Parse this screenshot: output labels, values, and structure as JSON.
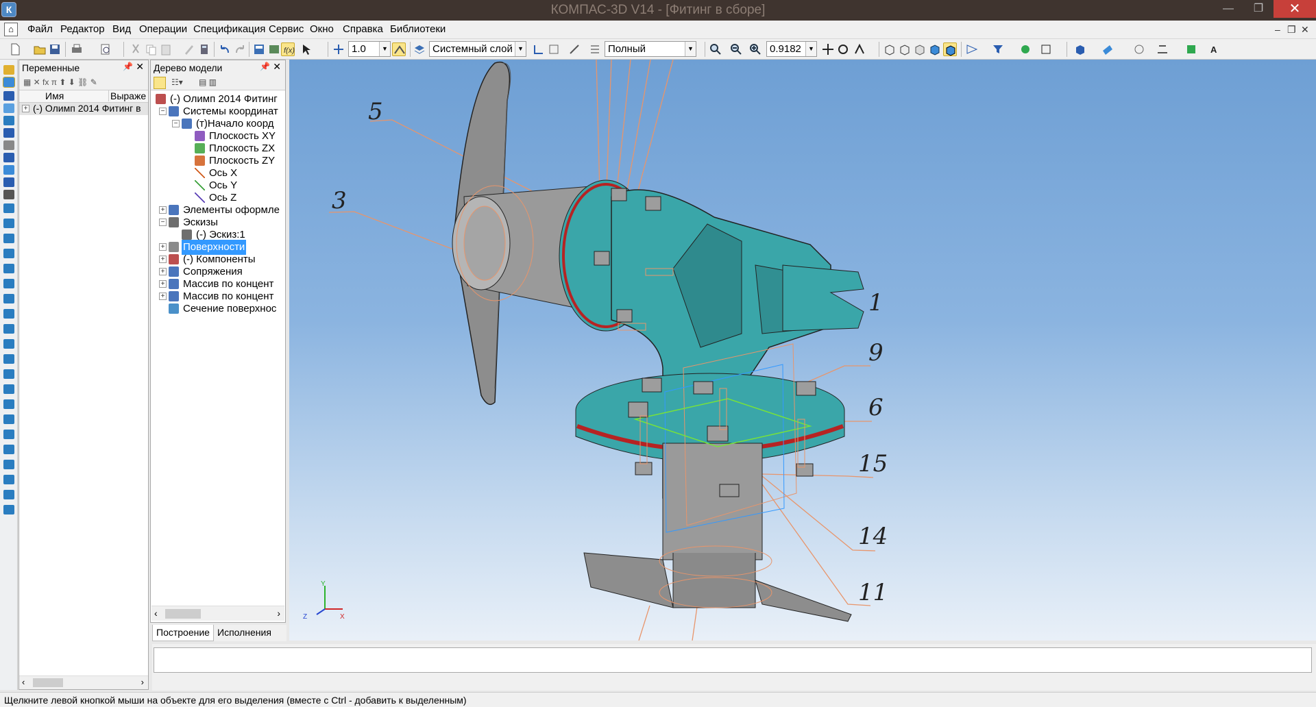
{
  "window": {
    "title": "КОМПАС-3D V14 - [Фитинг в сборе]",
    "app_icon": "К",
    "controls": {
      "minimize": "—",
      "maximize": "❐",
      "close": "✕"
    }
  },
  "menu": {
    "items": [
      "Файл",
      "Редактор",
      "Вид",
      "Операции",
      "Спецификация",
      "Сервис",
      "Окно",
      "Справка",
      "Библиотеки"
    ],
    "doc_controls": {
      "minimize": "–",
      "restore": "❐",
      "close": "✕"
    }
  },
  "toolbar": {
    "step_value": "1.0",
    "layer": "Системный слой",
    "display_mode": "Полный",
    "zoom": "0.9182"
  },
  "variables_panel": {
    "title": "Переменные",
    "columns": [
      "Имя",
      "Выраже"
    ],
    "rows": [
      "(-) Олимп 2014 Фитинг в"
    ]
  },
  "model_tree": {
    "title": "Дерево модели",
    "items": [
      {
        "label": "(-) Олимп 2014 Фитинг",
        "level": 0,
        "icon": "assembly-icon",
        "expander": ""
      },
      {
        "label": "Системы координат",
        "level": 1,
        "icon": "coordinate-system-icon",
        "expander": "−"
      },
      {
        "label": "(т)Начало коорд",
        "level": 2,
        "icon": "origin-icon",
        "expander": "−"
      },
      {
        "label": "Плоскость XY",
        "level": 3,
        "icon": "plane-xy-icon",
        "expander": ""
      },
      {
        "label": "Плоскость ZX",
        "level": 3,
        "icon": "plane-zx-icon",
        "expander": ""
      },
      {
        "label": "Плоскость ZY",
        "level": 3,
        "icon": "plane-zy-icon",
        "expander": ""
      },
      {
        "label": "Ось X",
        "level": 3,
        "icon": "axis-x-icon",
        "expander": ""
      },
      {
        "label": "Ось Y",
        "level": 3,
        "icon": "axis-y-icon",
        "expander": ""
      },
      {
        "label": "Ось Z",
        "level": 3,
        "icon": "axis-z-icon",
        "expander": ""
      },
      {
        "label": "Элементы оформле",
        "level": 1,
        "icon": "annotation-icon",
        "expander": "+"
      },
      {
        "label": "Эскизы",
        "level": 1,
        "icon": "sketches-icon",
        "expander": "−"
      },
      {
        "label": "(-) Эскиз:1",
        "level": 2,
        "icon": "sketch-icon",
        "expander": ""
      },
      {
        "label": "Поверхности",
        "level": 1,
        "icon": "surfaces-icon",
        "expander": "+",
        "selected": true
      },
      {
        "label": "(-) Компоненты",
        "level": 1,
        "icon": "components-icon",
        "expander": "+"
      },
      {
        "label": "Сопряжения",
        "level": 1,
        "icon": "mates-icon",
        "expander": "+"
      },
      {
        "label": "Массив по концент",
        "level": 1,
        "icon": "circular-array-icon",
        "expander": "+"
      },
      {
        "label": "Массив по концент",
        "level": 1,
        "icon": "circular-array-icon",
        "expander": "+"
      },
      {
        "label": "Сечение поверхнос",
        "level": 1,
        "icon": "section-icon",
        "expander": ""
      }
    ],
    "tabs": [
      "Построение",
      "Исполнения"
    ]
  },
  "viewport": {
    "callouts": [
      "5",
      "3",
      "1",
      "9",
      "6",
      "15",
      "14",
      "11"
    ],
    "axes": {
      "x": "X",
      "y": "Y",
      "z": "Z"
    }
  },
  "status": {
    "text": "Щелкните левой кнопкой мыши на объекте для его выделения (вместе с Ctrl - добавить к выделенным)"
  },
  "colors": {
    "model_teal": "#3aa6a9",
    "model_grey": "#8a8a8a",
    "gasket_red": "#b62323",
    "leader_orange": "#e8956b",
    "selection_blue": "#3399ff"
  }
}
